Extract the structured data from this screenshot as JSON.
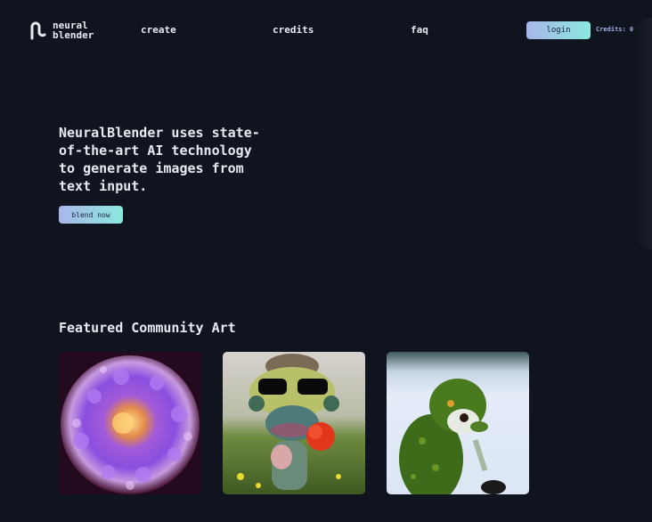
{
  "header": {
    "logo": {
      "line1": "neural",
      "line2": "blender",
      "icon": "neural-blender-logo-icon"
    },
    "nav": [
      {
        "label": "create"
      },
      {
        "label": "credits"
      },
      {
        "label": "faq"
      }
    ],
    "login_label": "login",
    "credits_text": "Credits: 0"
  },
  "hero": {
    "headline": "NeuralBlender uses state-of-the-art AI technology to generate images from text input.",
    "cta_label": "blend now"
  },
  "featured": {
    "title": "Featured Community Art",
    "items": [
      {
        "alt": "purple sea anemone artwork",
        "palette": [
          "#2a0b24",
          "#8a4fe0",
          "#f2a260"
        ]
      },
      {
        "alt": "creature with sunglasses in flower field",
        "palette": [
          "#cfc8c0",
          "#5f8a3a",
          "#e2361a"
        ]
      },
      {
        "alt": "green moss monkey with tool",
        "palette": [
          "#dfe8f5",
          "#3d6b1a",
          "#202020"
        ]
      }
    ]
  },
  "colors": {
    "background": "#0f141f",
    "button_gradient_start": "#a9b6ea",
    "button_gradient_end": "#8ae8dd",
    "credits_text": "#9fb3e6"
  }
}
